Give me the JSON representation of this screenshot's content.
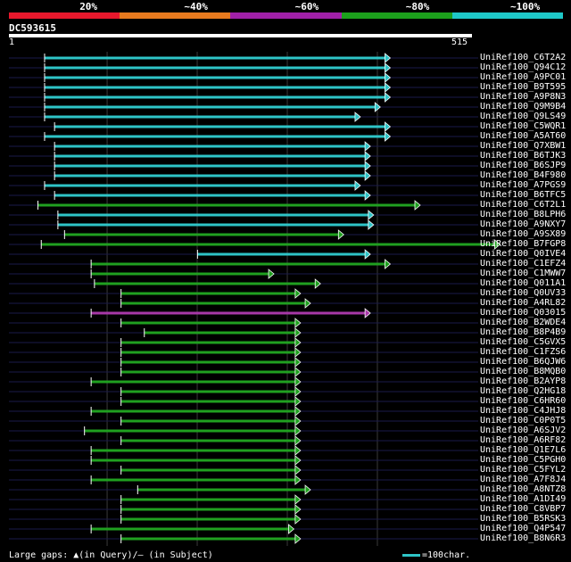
{
  "legend": [
    {
      "label": "20%",
      "color": "#e8182c"
    },
    {
      "label": "~40%",
      "color": "#e87a1e"
    },
    {
      "label": "~60%",
      "color": "#a020a8"
    },
    {
      "label": "~80%",
      "color": "#1ca01c"
    },
    {
      "label": "~100%",
      "color": "#1ec8c8"
    }
  ],
  "query": {
    "name": "DC593615",
    "start": "1",
    "end": "515"
  },
  "colors": {
    "cyan": "#2ec4c7",
    "green": "#20a020",
    "purple": "#a838a8",
    "grid": "#1a1a4a",
    "gridv": "#3a3a3a"
  },
  "hits": [
    {
      "id": "UniRef100_C6T2A2",
      "color": "cyan",
      "start": 55,
      "end": 575
    },
    {
      "id": "UniRef100_Q94C12",
      "color": "cyan",
      "start": 55,
      "end": 575
    },
    {
      "id": "UniRef100_A9PC01",
      "color": "cyan",
      "start": 55,
      "end": 575
    },
    {
      "id": "UniRef100_B9T595",
      "color": "cyan",
      "start": 55,
      "end": 575
    },
    {
      "id": "UniRef100_A9P8N3",
      "color": "cyan",
      "start": 55,
      "end": 575
    },
    {
      "id": "UniRef100_Q9M9B4",
      "color": "cyan",
      "start": 55,
      "end": 560
    },
    {
      "id": "UniRef100_Q9LS49",
      "color": "cyan",
      "start": 55,
      "end": 530
    },
    {
      "id": "UniRef100_C5WQR1",
      "color": "cyan",
      "start": 70,
      "end": 575
    },
    {
      "id": "UniRef100_A5AT60",
      "color": "cyan",
      "start": 55,
      "end": 575
    },
    {
      "id": "UniRef100_Q7XBW1",
      "color": "cyan",
      "start": 70,
      "end": 545
    },
    {
      "id": "UniRef100_B6TJK3",
      "color": "cyan",
      "start": 70,
      "end": 545
    },
    {
      "id": "UniRef100_B6SJP9",
      "color": "cyan",
      "start": 70,
      "end": 545
    },
    {
      "id": "UniRef100_B4F980",
      "color": "cyan",
      "start": 70,
      "end": 545
    },
    {
      "id": "UniRef100_A7PGS9",
      "color": "cyan",
      "start": 55,
      "end": 530
    },
    {
      "id": "UniRef100_B6TFC5",
      "color": "cyan",
      "start": 70,
      "end": 545
    },
    {
      "id": "UniRef100_C6T2L1",
      "color": "green",
      "start": 45,
      "end": 620
    },
    {
      "id": "UniRef100_B8LPH6",
      "color": "cyan",
      "start": 75,
      "end": 550
    },
    {
      "id": "UniRef100_A9NXY7",
      "color": "cyan",
      "start": 75,
      "end": 550
    },
    {
      "id": "UniRef100_A9SX89",
      "color": "green",
      "start": 85,
      "end": 505
    },
    {
      "id": "UniRef100_B7FGP8",
      "color": "green",
      "start": 50,
      "end": 740
    },
    {
      "id": "UniRef100_Q0IVE4",
      "color": "cyan",
      "start": 285,
      "end": 545
    },
    {
      "id": "UniRef100_C1EFZ4",
      "color": "green",
      "start": 125,
      "end": 575
    },
    {
      "id": "UniRef100_C1MWW7",
      "color": "green",
      "start": 125,
      "end": 400
    },
    {
      "id": "UniRef100_Q011A1",
      "color": "green",
      "start": 130,
      "end": 470
    },
    {
      "id": "UniRef100_Q0UV33",
      "color": "green",
      "start": 170,
      "end": 440
    },
    {
      "id": "UniRef100_A4RL82",
      "color": "green",
      "start": 170,
      "end": 455
    },
    {
      "id": "UniRef100_Q03015",
      "color": "purple",
      "start": 125,
      "end": 545
    },
    {
      "id": "UniRef100_B2WDE4",
      "color": "green",
      "start": 170,
      "end": 440
    },
    {
      "id": "UniRef100_B8P4B9",
      "color": "green",
      "start": 205,
      "end": 440
    },
    {
      "id": "UniRef100_C5GVX5",
      "color": "green",
      "start": 170,
      "end": 440
    },
    {
      "id": "UniRef100_C1FZS6",
      "color": "green",
      "start": 170,
      "end": 440
    },
    {
      "id": "UniRef100_B6QJW6",
      "color": "green",
      "start": 170,
      "end": 440
    },
    {
      "id": "UniRef100_B8MQB0",
      "color": "green",
      "start": 170,
      "end": 440
    },
    {
      "id": "UniRef100_B2AYP8",
      "color": "green",
      "start": 125,
      "end": 440
    },
    {
      "id": "UniRef100_Q2HG18",
      "color": "green",
      "start": 170,
      "end": 440
    },
    {
      "id": "UniRef100_C6HR60",
      "color": "green",
      "start": 170,
      "end": 440
    },
    {
      "id": "UniRef100_C4JHJ8",
      "color": "green",
      "start": 125,
      "end": 440
    },
    {
      "id": "UniRef100_C0P0T5",
      "color": "green",
      "start": 170,
      "end": 440
    },
    {
      "id": "UniRef100_A6SJV2",
      "color": "green",
      "start": 115,
      "end": 440
    },
    {
      "id": "UniRef100_A6RF82",
      "color": "green",
      "start": 170,
      "end": 440
    },
    {
      "id": "UniRef100_Q1E7L6",
      "color": "green",
      "start": 125,
      "end": 440
    },
    {
      "id": "UniRef100_C5PGH0",
      "color": "green",
      "start": 125,
      "end": 440
    },
    {
      "id": "UniRef100_C5FYL2",
      "color": "green",
      "start": 170,
      "end": 440
    },
    {
      "id": "UniRef100_A7F8J4",
      "color": "green",
      "start": 125,
      "end": 440
    },
    {
      "id": "UniRef100_A8NTZ8",
      "color": "green",
      "start": 195,
      "end": 455
    },
    {
      "id": "UniRef100_A1DI49",
      "color": "green",
      "start": 170,
      "end": 440
    },
    {
      "id": "UniRef100_C8VBP7",
      "color": "green",
      "start": 170,
      "end": 440
    },
    {
      "id": "UniRef100_B5RSK3",
      "color": "green",
      "start": 170,
      "end": 440
    },
    {
      "id": "UniRef100_Q4P547",
      "color": "green",
      "start": 125,
      "end": 430
    },
    {
      "id": "UniRef100_B8N6R3",
      "color": "green",
      "start": 170,
      "end": 440
    }
  ],
  "footer": {
    "gaps_text": "Large gaps: ▲(in Query)/— (in Subject)",
    "scale_text": "=100char."
  }
}
